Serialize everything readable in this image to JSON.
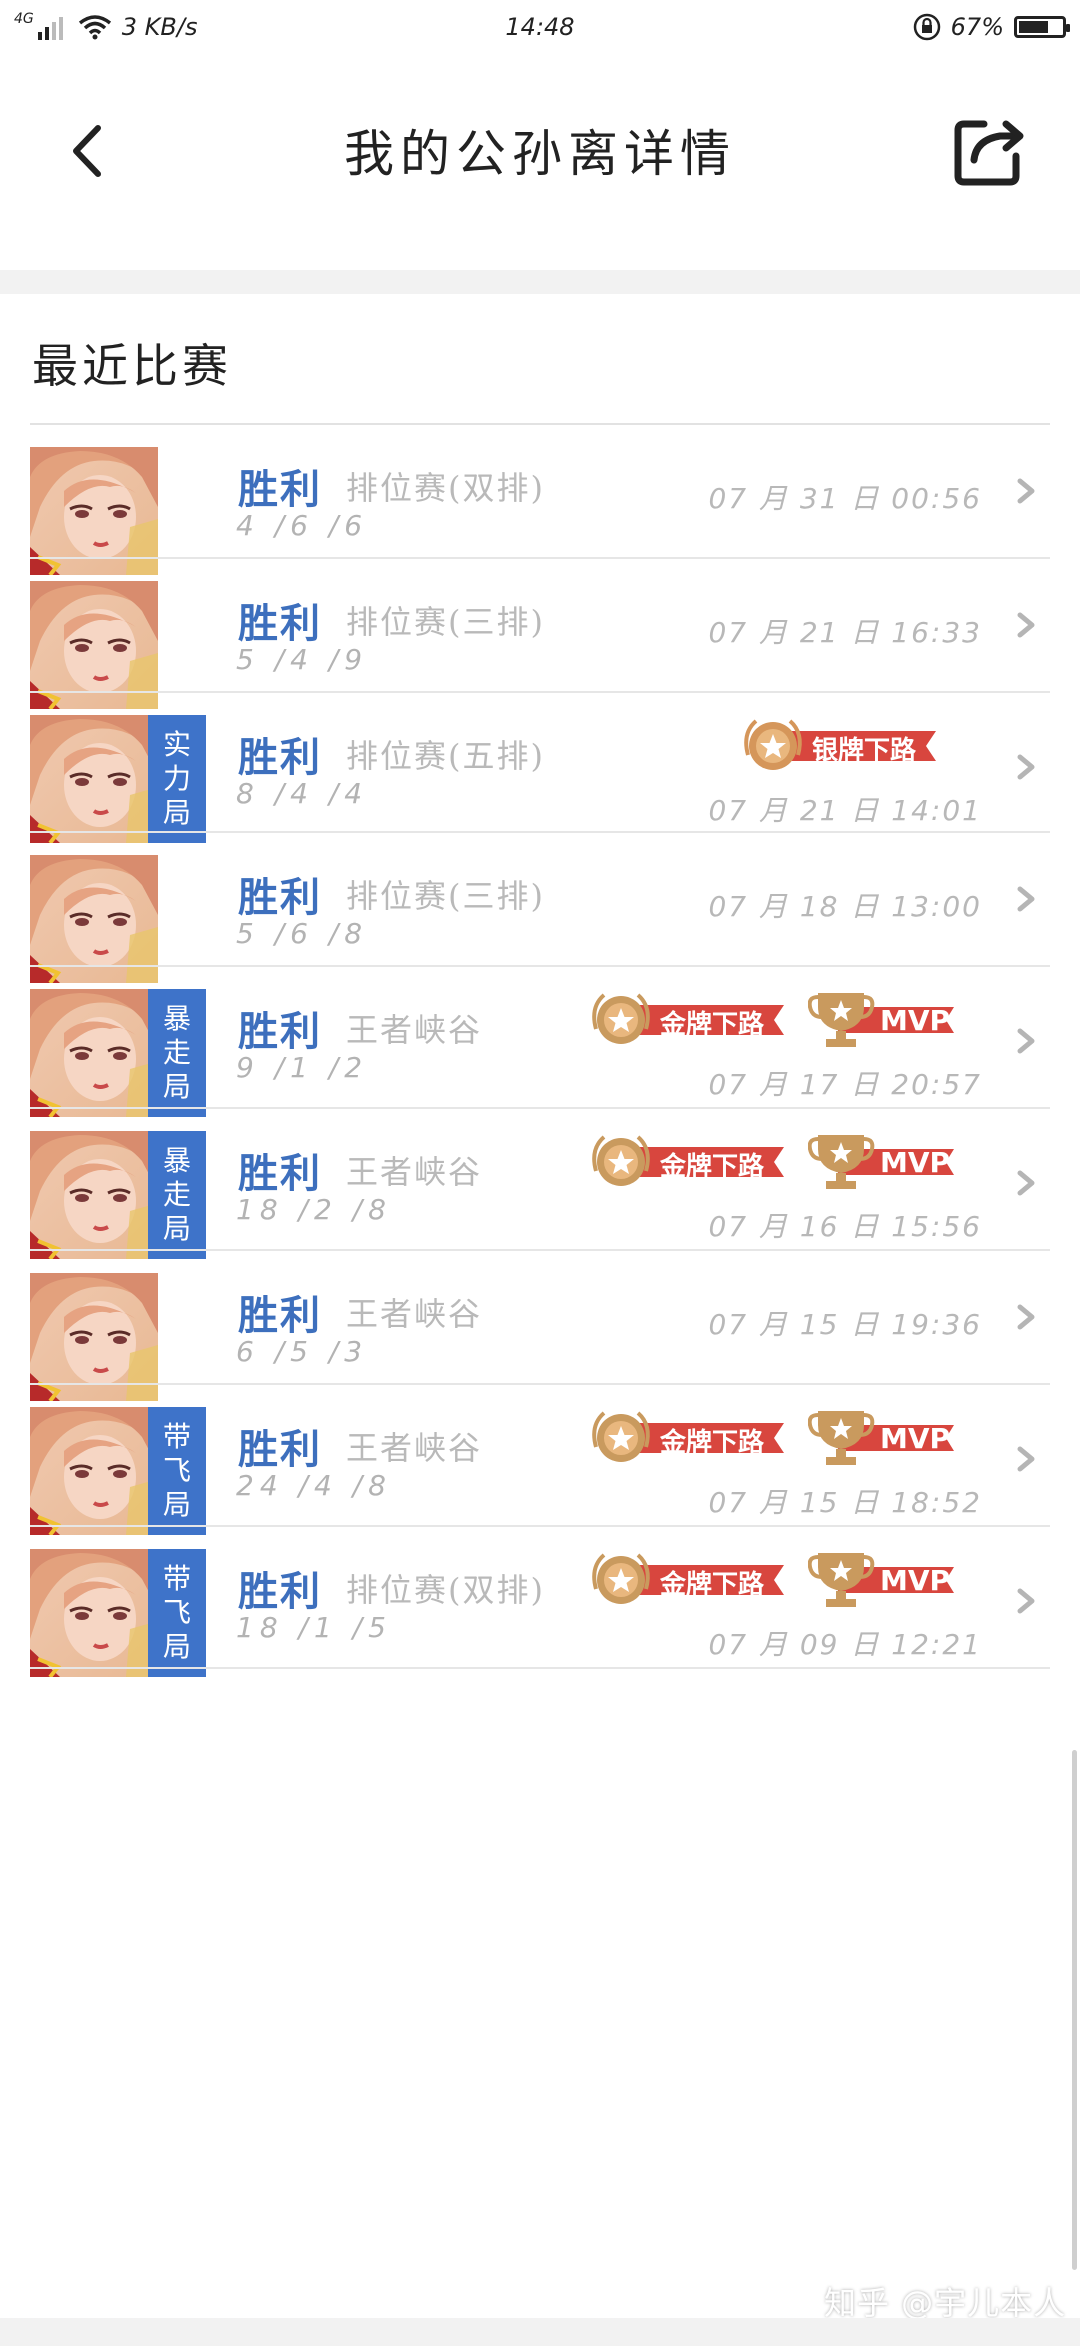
{
  "status_bar": {
    "network": "4G",
    "speed": "3 KB/s",
    "time": "14:48",
    "battery_percent": "67%",
    "battery_level": 0.67
  },
  "header": {
    "title": "我的公孙离详情",
    "back_icon": "chevron-left-icon",
    "share_icon": "share-icon"
  },
  "section": {
    "title": "最近比赛"
  },
  "matches": [
    {
      "result": "胜利",
      "mode": "排位赛(双排)",
      "kda": "4 /6 /6",
      "date": "07 月 31 日  00:56",
      "tag": "",
      "medal": "",
      "mvp": ""
    },
    {
      "result": "胜利",
      "mode": "排位赛(三排)",
      "kda": "5 /4 /9",
      "date": "07 月 21 日  16:33",
      "tag": "",
      "medal": "",
      "mvp": ""
    },
    {
      "result": "胜利",
      "mode": "排位赛(五排)",
      "kda": "8 /4 /4",
      "date": "07 月 21 日  14:01",
      "tag": "实力局",
      "medal": "银牌下路",
      "mvp": ""
    },
    {
      "result": "胜利",
      "mode": "排位赛(三排)",
      "kda": "5 /6 /8",
      "date": "07 月 18 日  13:00",
      "tag": "",
      "medal": "",
      "mvp": ""
    },
    {
      "result": "胜利",
      "mode": "王者峡谷",
      "kda": "9 /1 /2",
      "date": "07 月 17 日  20:57",
      "tag": "暴走局",
      "medal": "金牌下路",
      "mvp": "MVP"
    },
    {
      "result": "胜利",
      "mode": "王者峡谷",
      "kda": "18 /2 /8",
      "date": "07 月 16 日  15:56",
      "tag": "暴走局",
      "medal": "金牌下路",
      "mvp": "MVP"
    },
    {
      "result": "胜利",
      "mode": "王者峡谷",
      "kda": "6 /5 /3",
      "date": "07 月 15 日  19:36",
      "tag": "",
      "medal": "",
      "mvp": ""
    },
    {
      "result": "胜利",
      "mode": "王者峡谷",
      "kda": "24 /4 /8",
      "date": "07 月 15 日  18:52",
      "tag": "带飞局",
      "medal": "金牌下路",
      "mvp": "MVP"
    },
    {
      "result": "胜利",
      "mode": "排位赛(双排)",
      "kda": "18 /1 /5",
      "date": "07 月 09 日  12:21",
      "tag": "带飞局",
      "medal": "金牌下路",
      "mvp": "MVP"
    }
  ],
  "watermark": "知乎 @宇儿本人",
  "colors": {
    "result_blue": "#3d6fbd",
    "tag_blue": "#3e73c9",
    "badge_red": "#d9413a",
    "gold": "#c9a063",
    "silver": "#d49a5a"
  }
}
